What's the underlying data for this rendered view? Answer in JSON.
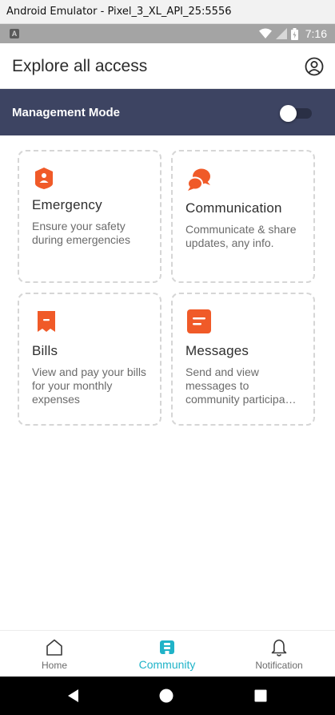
{
  "window": {
    "title": "Android Emulator - Pixel_3_XL_API_25:5556"
  },
  "status_bar": {
    "time": "7:16",
    "notification_glyph": "A"
  },
  "header": {
    "title": "Explore all access",
    "profile_icon": "user-circle-icon"
  },
  "management": {
    "label": "Management Mode",
    "toggle_on": false
  },
  "colors": {
    "accent": "#f05a28",
    "nav_active": "#20b3c8",
    "mgmt_bg": "#3d4462"
  },
  "cards": [
    {
      "title": "Emergency",
      "description": "Ensure your safety during emergencies",
      "icon": "shield-icon"
    },
    {
      "title": "Communication",
      "description": "Communicate & share updates, any info.",
      "icon": "chat-bubbles-icon"
    },
    {
      "title": "Bills",
      "description": "View and pay your bills for your monthly expenses",
      "icon": "receipt-icon"
    },
    {
      "title": "Messages",
      "description": "Send and view messages to community participa…",
      "icon": "message-icon"
    }
  ],
  "bottom_nav": {
    "items": [
      {
        "label": "Home",
        "icon": "home-icon",
        "active": false
      },
      {
        "label": "Community",
        "icon": "community-icon",
        "active": true
      },
      {
        "label": "Notification",
        "icon": "bell-icon",
        "active": false
      }
    ]
  }
}
